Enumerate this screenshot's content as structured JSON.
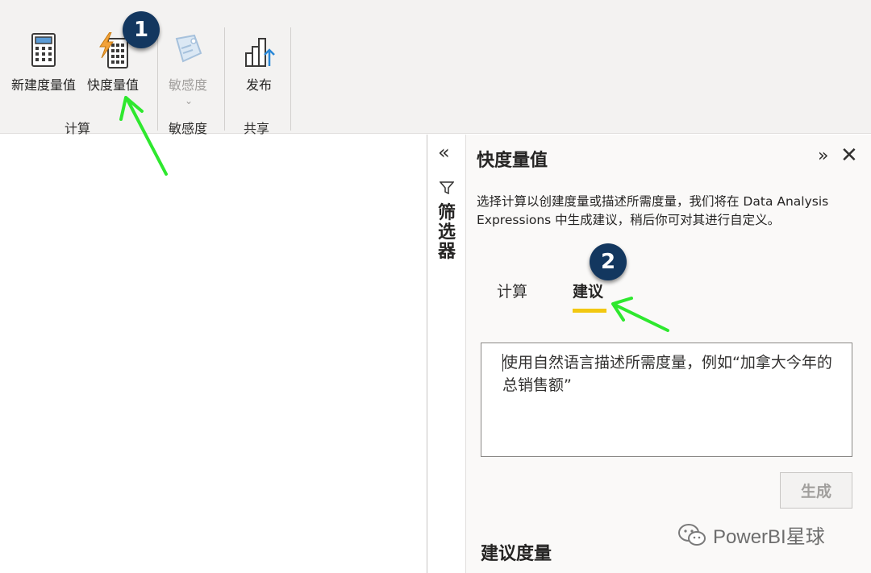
{
  "ribbon": {
    "new_measure_label": "新建度量值",
    "quick_measure_label": "快度量值",
    "sensitivity_label": "敏感度",
    "publish_label": "发布",
    "groups": {
      "calculation": "计算",
      "sensitivity": "敏感度",
      "share": "共享"
    }
  },
  "filters": {
    "label": "筛选器"
  },
  "quick_measure_pane": {
    "title": "快度量值",
    "description": "选择计算以创建度量或描述所需度量，我们将在 Data Analysis Expressions 中生成建议，稍后你可对其进行自定义。",
    "tabs": [
      {
        "label": "计算",
        "active": false
      },
      {
        "label": "建议",
        "active": true
      }
    ],
    "prompt_placeholder": "使用自然语言描述所需度量，例如“加拿大今年的总销售额”",
    "generate_label": "生成",
    "suggested_measures_title": "建议度量"
  },
  "annotations": {
    "badge_1": "1",
    "badge_2": "2",
    "badge_color": "#13375f",
    "arrow_color": "#2ee82e"
  },
  "watermark": {
    "text": "PowerBI星球"
  },
  "colors": {
    "ribbon_bg": "#f3f2f1",
    "pane_bg": "#faf9f8",
    "tab_underline": "#f2c811"
  }
}
